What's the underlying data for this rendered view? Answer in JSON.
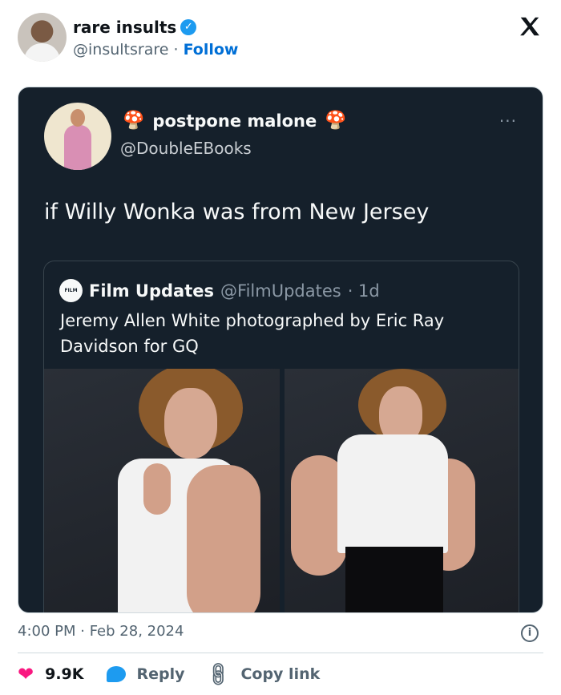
{
  "author": {
    "name": "rare insults",
    "handle": "@insultsrare",
    "separator": "·",
    "follow_label": "Follow"
  },
  "embedded_tweet": {
    "name": "postpone malone",
    "name_emoji": "🍄",
    "handle": "@DoubleEBooks",
    "more_label": "···",
    "text": "if Willy Wonka was from New Jersey",
    "quote": {
      "avatar_text": "FILM UPDATES",
      "name": "Film Updates",
      "handle": "@FilmUpdates",
      "age": "· 1d",
      "text": "Jeremy Allen White photographed by Eric Ray Davidson for GQ"
    }
  },
  "timestamp": "4:00 PM · Feb 28, 2024",
  "actions": {
    "likes": "9.9K",
    "reply_label": "Reply",
    "copy_label": "Copy link"
  },
  "colors": {
    "accent": "#1d9bf0",
    "follow": "#006fd6",
    "heart": "#f91880",
    "embed_bg": "#15202b"
  }
}
